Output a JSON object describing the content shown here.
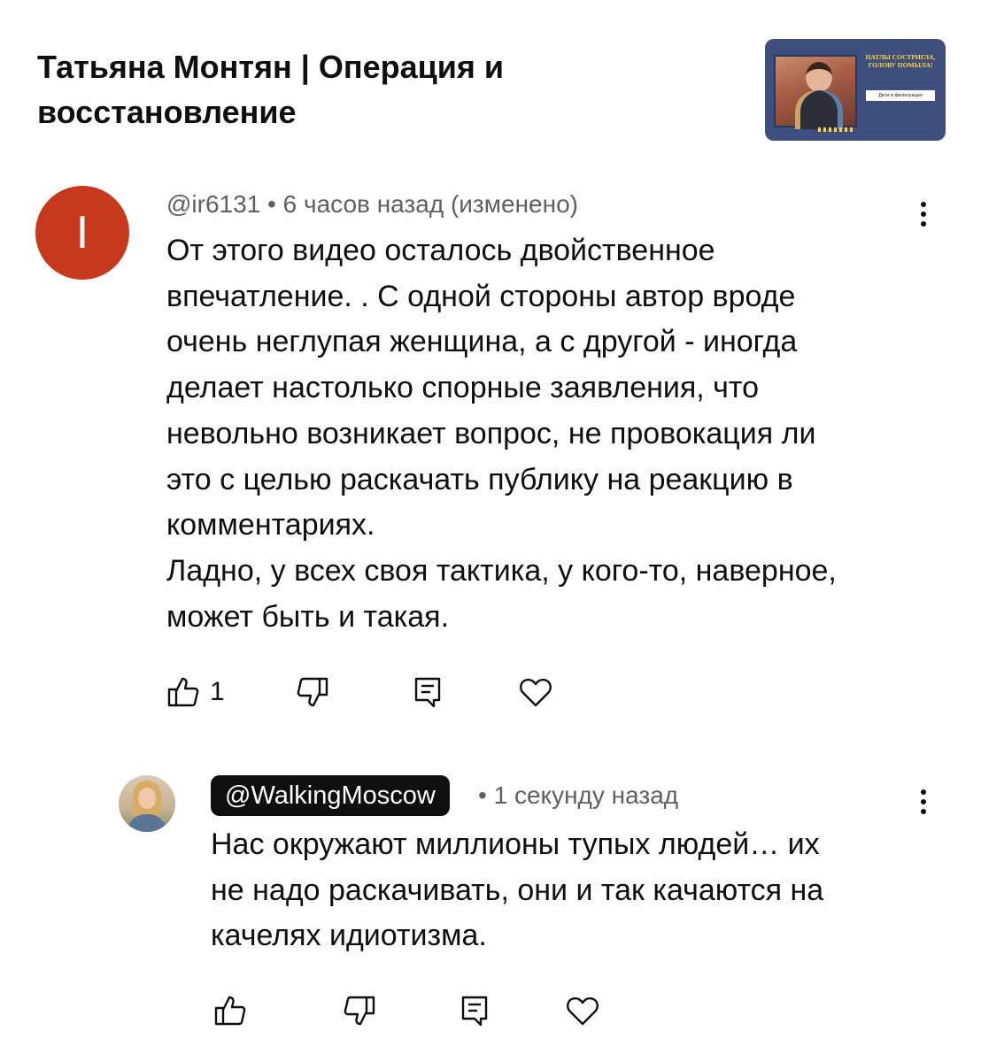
{
  "video": {
    "title_line1": "Татьяна Монтян | Операция и",
    "title_line2": "восстановление",
    "thumbnail": {
      "headline": "ПАТЛЫ СОСТРИГЛА, ГОЛОВУ ПОМЫЛА!",
      "tag": "Дети и фильтрация"
    }
  },
  "comment": {
    "avatar_letter": "I",
    "avatar_color": "#c6391c",
    "author": "@ir6131",
    "separator": "•",
    "time": "6 часов назад (изменено)",
    "text_lines": [
      "От этого видео осталось двойственное",
      "впечатление. . С одной стороны автор вроде",
      "очень неглупая женщина, а с другой - иногда",
      "делает настолько спорные заявления, что",
      "невольно возникает вопрос, не провокация ли",
      "это с целью раскачать публику на реакцию в",
      "комментариях.",
      "Ладно, у всех своя тактика, у кого-то, наверное,",
      "может быть и такая."
    ],
    "like_count": "1",
    "icons": [
      "thumbs-up-icon",
      "thumbs-down-icon",
      "reply-icon",
      "heart-icon",
      "more-vert-icon"
    ]
  },
  "reply": {
    "author": "@WalkingMoscow",
    "separator": "•",
    "time": "1 секунду назад",
    "text_lines": [
      "Нас окружают миллионы тупых людей… их",
      "не надо раскачивать, они и так качаются на",
      "качелях идиотизма."
    ],
    "icons": [
      "thumbs-up-icon",
      "thumbs-down-icon",
      "reply-icon",
      "heart-icon",
      "more-vert-icon"
    ]
  }
}
